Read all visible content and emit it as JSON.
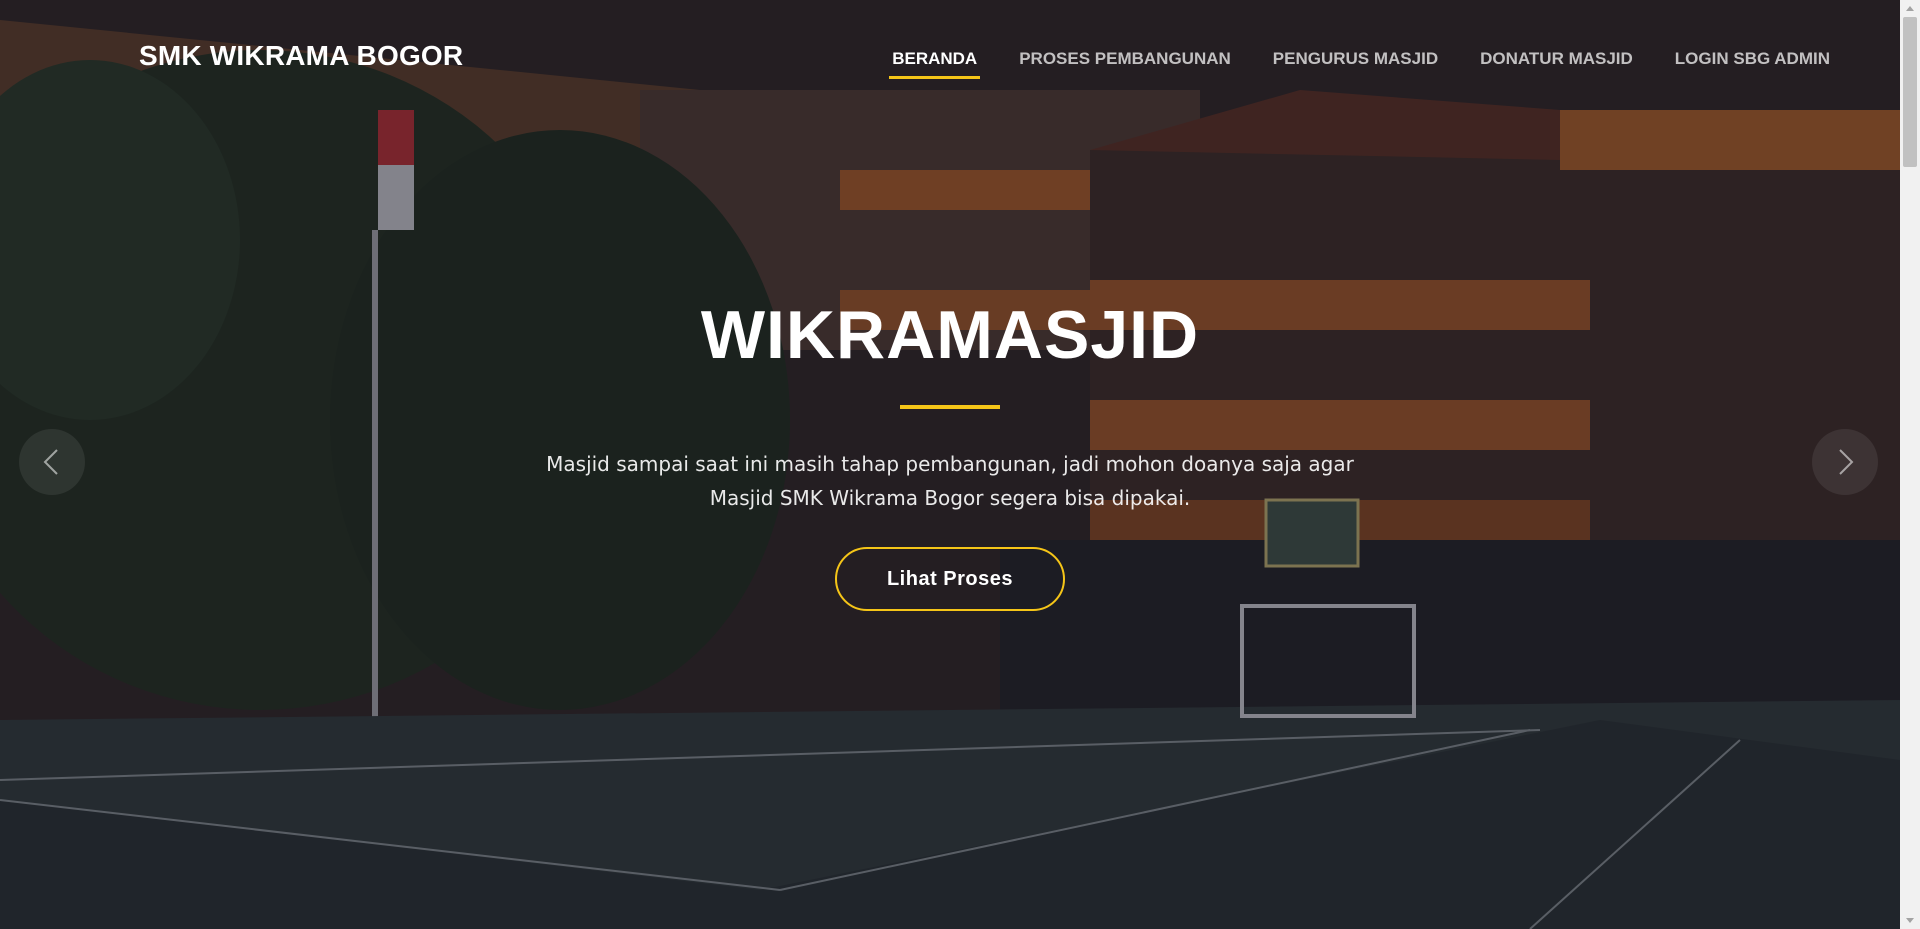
{
  "brand": {
    "name": "SMK WIKRAMA BOGOR"
  },
  "nav": {
    "items": [
      {
        "label": "BERANDA",
        "active": true
      },
      {
        "label": "PROSES PEMBANGUNAN"
      },
      {
        "label": "PENGURUS MASJID"
      },
      {
        "label": "DONATUR MASJID"
      },
      {
        "label": "LOGIN SBG ADMIN"
      }
    ]
  },
  "hero": {
    "title": "WIKRAMASJID",
    "description": "Masjid sampai saat ini masih tahap pembangunan, jadi mohon doanya saja agar Masjid SMK Wikrama Bogor segera bisa dipakai.",
    "button_label": "Lihat Proses"
  },
  "carousel": {
    "prev_icon": "chevron-left-icon",
    "next_icon": "chevron-right-icon"
  },
  "colors": {
    "accent": "#f5c518",
    "overlay": "#0a0c1c",
    "text": "#ffffff"
  }
}
